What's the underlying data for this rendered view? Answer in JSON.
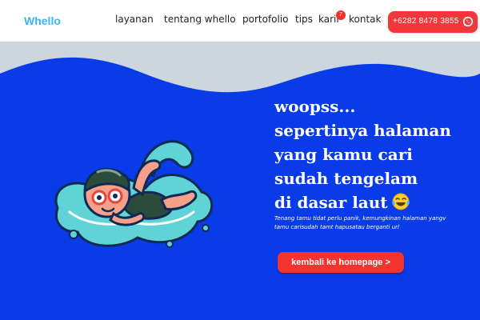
{
  "header": {
    "logo": "Whello",
    "nav": [
      {
        "label": "layanan"
      },
      {
        "label": "tentang whello"
      },
      {
        "label": "portofolio"
      },
      {
        "label": "tips"
      },
      {
        "label": "karir",
        "badge": "7"
      },
      {
        "label": "kontak"
      }
    ],
    "phone_button": {
      "label": "+6282 8478 3855",
      "icon": "whatsapp-icon"
    }
  },
  "hero": {
    "headline": [
      "woopss...",
      "sepertinya halaman",
      "yang kamu cari",
      "sudah tengelam",
      "di dasar laut"
    ],
    "headline_emoji": "face-with-tears-of-joy-icon",
    "subtext": "Tenang tamu tidat perlu panik, kemungkinan halaman yangv tamu carisudah tamt hapusatau berganti url",
    "button_label": "kembali ke homepage >",
    "illustration": "swimmer-illustration"
  },
  "colors": {
    "hero_blue": "#0a3be8",
    "wave_grey": "#ccd6df",
    "accent_red": "#f0383a",
    "logo_blue": "#3bb4f2",
    "water_teal": "#5fd3d6"
  }
}
